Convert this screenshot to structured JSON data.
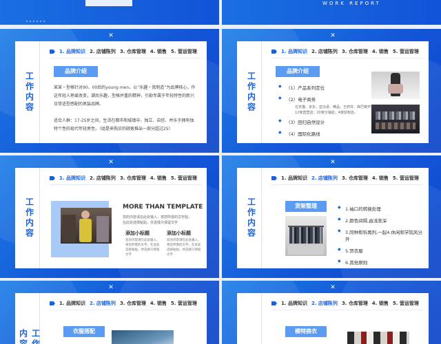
{
  "header": {
    "work_report": "WORK REPORT"
  },
  "nav": [
    "1. 品牌知识",
    "2. 店铺陈列",
    "3. 仓库管理",
    "4. 销售",
    "5. 营运管理"
  ],
  "sidebar_title": "工作内容",
  "slides": {
    "s1": {
      "tag": "品牌介绍",
      "para1": "某某・型格针对90、00后的young men，以“乐趣・我制造”为品牌核心，作这年轻人熟爱改变，潮尚乐趣，型格并重的精神，引勒专属于年轻特性的新兴日常适型感配的男装品牌。",
      "para2": "适合人群：17-25岁之间，生活在都市和城镇中，独立、自信、并乐于拥有独特个性的现代年轻男性。（组是来购买的顾客推出一部分超过25）"
    },
    "s2": {
      "tag": "品牌介绍",
      "items": [
        "（1）产品系列定位",
        "（2）电子商务",
        "（3）回归自然设计",
        "（4）国际化路线"
      ],
      "sub": "在天猫、京东、亚马逊、唯品、王府井、库巴等开有12家直营店；20家分销店；4家授权店。"
    },
    "s3": {
      "heading": "MORE THAN TEMPLATE",
      "desc": "您的内容请在此处输入，将您所需的文字贴，在此处选择粘贴，并选择只保留文字",
      "sub1": "添加小标题",
      "sub2": "添加小标题",
      "sub_desc": "您的内容请在此处输入，将您所需的文字，在此处选择粘贴，并选择只保留文字"
    },
    "s4": {
      "tag": "货架整理",
      "items": [
        "1.袖口的转换处理",
        "2.颜色间隔,由浅至深",
        "3.同种和科再列,一起4.休闲和学院风分开",
        "5.贺衣服",
        "6.其他原则"
      ]
    },
    "s5": {
      "tag": "衣服搭配"
    },
    "s6": {
      "tag": "模特换衣"
    }
  },
  "colors": {
    "accent": "#1b62d9",
    "tag": "#5b9bf2",
    "bg_blue": "#1356d8"
  }
}
